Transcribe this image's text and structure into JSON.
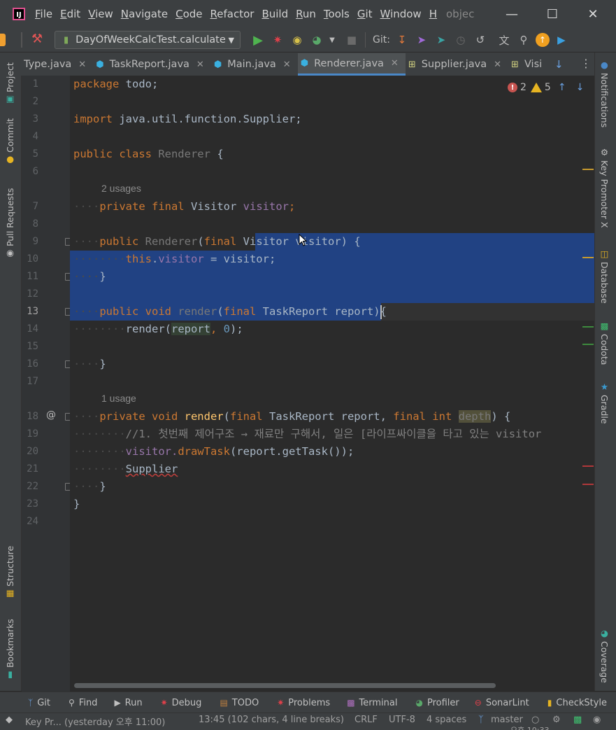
{
  "menubar": {
    "logo": "IJ",
    "items": [
      "File",
      "Edit",
      "View",
      "Navigate",
      "Code",
      "Refactor",
      "Build",
      "Run",
      "Tools",
      "Git",
      "Window",
      "H"
    ],
    "project_hint": "objec"
  },
  "toolbar": {
    "run_config": "DayOfWeekCalcTest.calculate",
    "git_label": "Git:"
  },
  "tabs": [
    {
      "label": "Type.java",
      "icon": "java-class-icon"
    },
    {
      "label": "TaskReport.java",
      "icon": "java-class-icon"
    },
    {
      "label": "Main.java",
      "icon": "java-class-icon"
    },
    {
      "label": "Renderer.java",
      "icon": "java-class-icon",
      "active": true
    },
    {
      "label": "Supplier.java",
      "icon": "interface-icon"
    },
    {
      "label": "Visi",
      "icon": "interface-icon"
    }
  ],
  "left_tools": [
    "Project",
    "Commit",
    "Pull Requests",
    "Structure",
    "Bookmarks"
  ],
  "right_tools": [
    "Notifications",
    "Key Promoter X",
    "Database",
    "Codota",
    "Gradle",
    "Coverage"
  ],
  "inspections": {
    "errors": "2",
    "warnings": "5"
  },
  "code": {
    "line_numbers": [
      "1",
      "2",
      "3",
      "4",
      "5",
      "6",
      "7",
      "8",
      "9",
      "10",
      "11",
      "12",
      "13",
      "14",
      "15",
      "16",
      "17",
      "18",
      "19",
      "20",
      "21",
      "22",
      "23",
      "24"
    ],
    "hint_7": "2 usages",
    "hint_18": "1 usage",
    "l1_kw": "package",
    "l1_rest": " todo;",
    "l3_kw": "import",
    "l3_rest": " java.util.function.Supplier;",
    "l5_kw": "public class",
    "l5_name": " Renderer",
    "l5_rest": " {",
    "l7_kw": "private final",
    "l7_type": " Visitor ",
    "l7_fld": "visitor",
    "l7_end": ";",
    "l9_kw": "public",
    "l9_name": " Renderer",
    "l9_p": "(",
    "l9_kw2": "final",
    "l9_type": " Visitor visitor",
    "l9_end": ") {",
    "l10_this": "this",
    "l10_dot": ".",
    "l10_fld": "visitor",
    "l10_rest": " = visitor;",
    "l11": "}",
    "l13_kw": "public void",
    "l13_name": " render",
    "l13_p": "(",
    "l13_kw2": "final",
    "l13_rest": " TaskReport report){",
    "l14_a": "render(",
    "l14_param": "report",
    "l14_b": ", ",
    "l14_num": "0",
    "l14_c": ");",
    "l16": "}",
    "l18_kw": "private void",
    "l18_mth": " render",
    "l18_p": "(",
    "l18_kw2": "final",
    "l18_mid": " TaskReport report, ",
    "l18_kw3": "final int",
    "l18_sp": " ",
    "l18_warn": "depth",
    "l18_end": ") {",
    "l19_cm": "//1. 첫번째 제어구조 → 재료만 구해서, 일은 [라이프싸이클을 타고 있는 visitor",
    "l20_a": "visitor.",
    "l20_m": "drawTask",
    "l20_b": "(report.getTask());",
    "l21": "Supplier",
    "l22": "}",
    "l23": "}"
  },
  "bottom_tools": [
    {
      "label": "Git",
      "icon": "git-branch-icon"
    },
    {
      "label": "Find",
      "icon": "find-icon"
    },
    {
      "label": "Run",
      "icon": "run-icon"
    },
    {
      "label": "Debug",
      "icon": "debug-icon"
    },
    {
      "label": "TODO",
      "icon": "todo-icon"
    },
    {
      "label": "Problems",
      "icon": "problems-icon"
    },
    {
      "label": "Terminal",
      "icon": "terminal-icon"
    },
    {
      "label": "Profiler",
      "icon": "profiler-icon"
    },
    {
      "label": "SonarLint",
      "icon": "sonarlint-icon"
    },
    {
      "label": "CheckStyle",
      "icon": "checkstyle-icon"
    }
  ],
  "status": {
    "message": "Key Pr... (yesterday 오후 11:00)",
    "position": "13:45 (102 chars, 4 line breaks)",
    "line_sep": "CRLF",
    "encoding": "UTF-8",
    "indent": "4 spaces",
    "branch": "master",
    "clock": "오후 10:33"
  },
  "colors": {
    "accent": "#4a88c7",
    "selection": "#214283",
    "error": "#c75450",
    "warning": "#e6b422"
  }
}
